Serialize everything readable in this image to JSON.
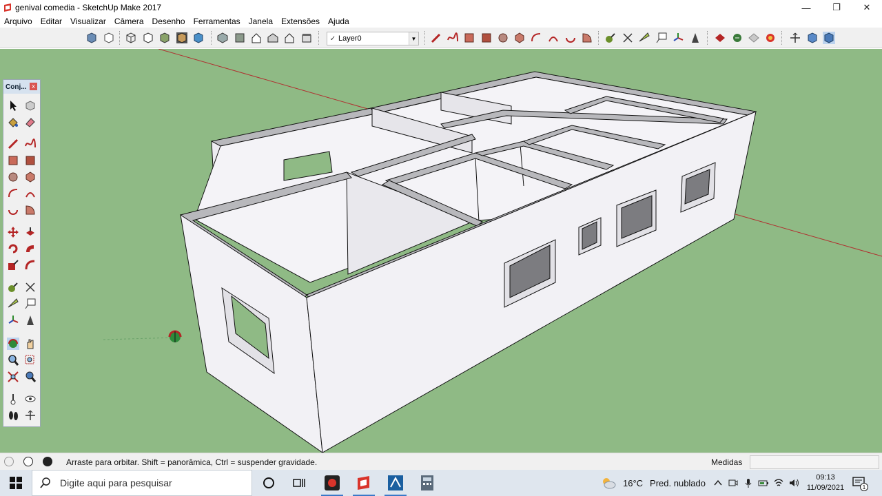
{
  "window": {
    "title": "genival comedia - SketchUp Make 2017",
    "minimize": "—",
    "restore": "❐",
    "close": "✕"
  },
  "menu": {
    "items": [
      "Arquivo",
      "Editar",
      "Visualizar",
      "Câmera",
      "Desenho",
      "Ferramentas",
      "Janela",
      "Extensões",
      "Ajuda"
    ]
  },
  "toolbar": {
    "layer_value": "Layer0",
    "layer_check": "✓",
    "layer_arrow": "▼"
  },
  "palette": {
    "title": "Conj...",
    "close": "x"
  },
  "status": {
    "hint": "Arraste para orbitar. Shift = panorâmica, Ctrl = suspender gravidade.",
    "measures_label": "Medidas"
  },
  "taskbar": {
    "search_placeholder": "Digite aqui para pesquisar",
    "weather_temp": "16°C",
    "weather_text": "Pred. nublado",
    "time": "09:13",
    "date": "11/09/2021",
    "notif_count": "1"
  },
  "colors": {
    "sky_ground": "#8fba85",
    "wall_face": "#f2f1f5",
    "wall_top": "#b8b8bc",
    "axis_red": "#b03030",
    "accent": "#3a79c8"
  }
}
